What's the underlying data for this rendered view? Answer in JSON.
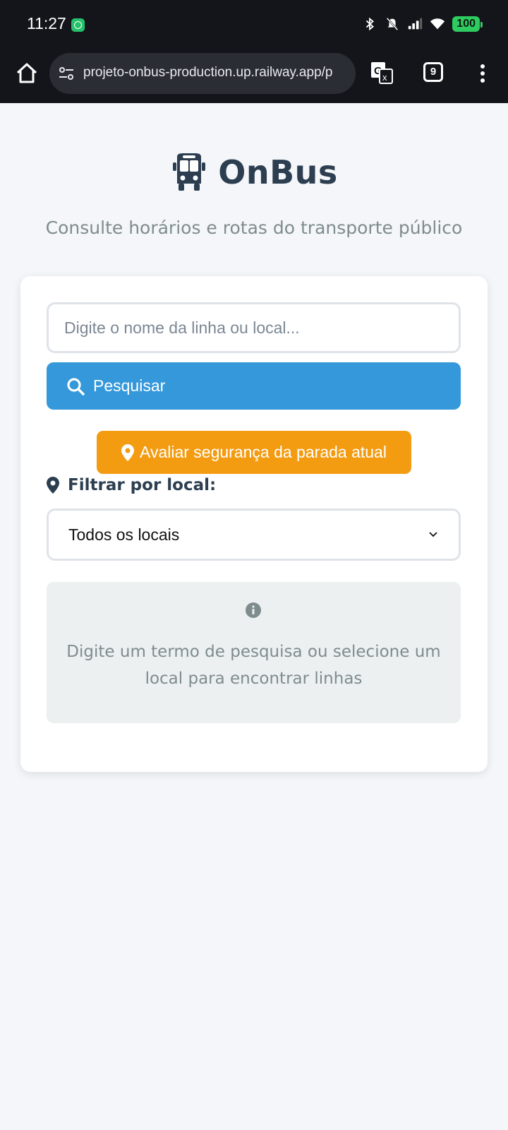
{
  "status_bar": {
    "time": "11:27",
    "battery": "100",
    "icons": [
      "whatsapp-icon",
      "bluetooth-icon",
      "mute-icon",
      "signal-icon",
      "wifi-icon",
      "battery-icon"
    ]
  },
  "browser": {
    "url": "projeto-onbus-production.up.railway.app/p",
    "tab_count": "9",
    "icons": [
      "home-icon",
      "site-settings-icon",
      "translate-icon",
      "tabs-icon",
      "more-menu-icon"
    ]
  },
  "header": {
    "title": "OnBus",
    "subtitle": "Consulte horários e rotas do transporte público",
    "icon": "bus-icon"
  },
  "search": {
    "placeholder": "Digite o nome da linha ou local...",
    "value": "",
    "button_label": "Pesquisar"
  },
  "safety": {
    "button_label": "Avaliar segurança da parada atual"
  },
  "filter": {
    "label": "Filtrar por local:",
    "selected": "Todos os locais"
  },
  "info": {
    "message": "Digite um termo de pesquisa ou selecione um local para encontrar linhas"
  },
  "colors": {
    "primary": "#3498db",
    "warning": "#f39c12",
    "heading": "#2c3e50",
    "muted": "#7f8c8d",
    "info_bg": "#ecf0f1"
  }
}
